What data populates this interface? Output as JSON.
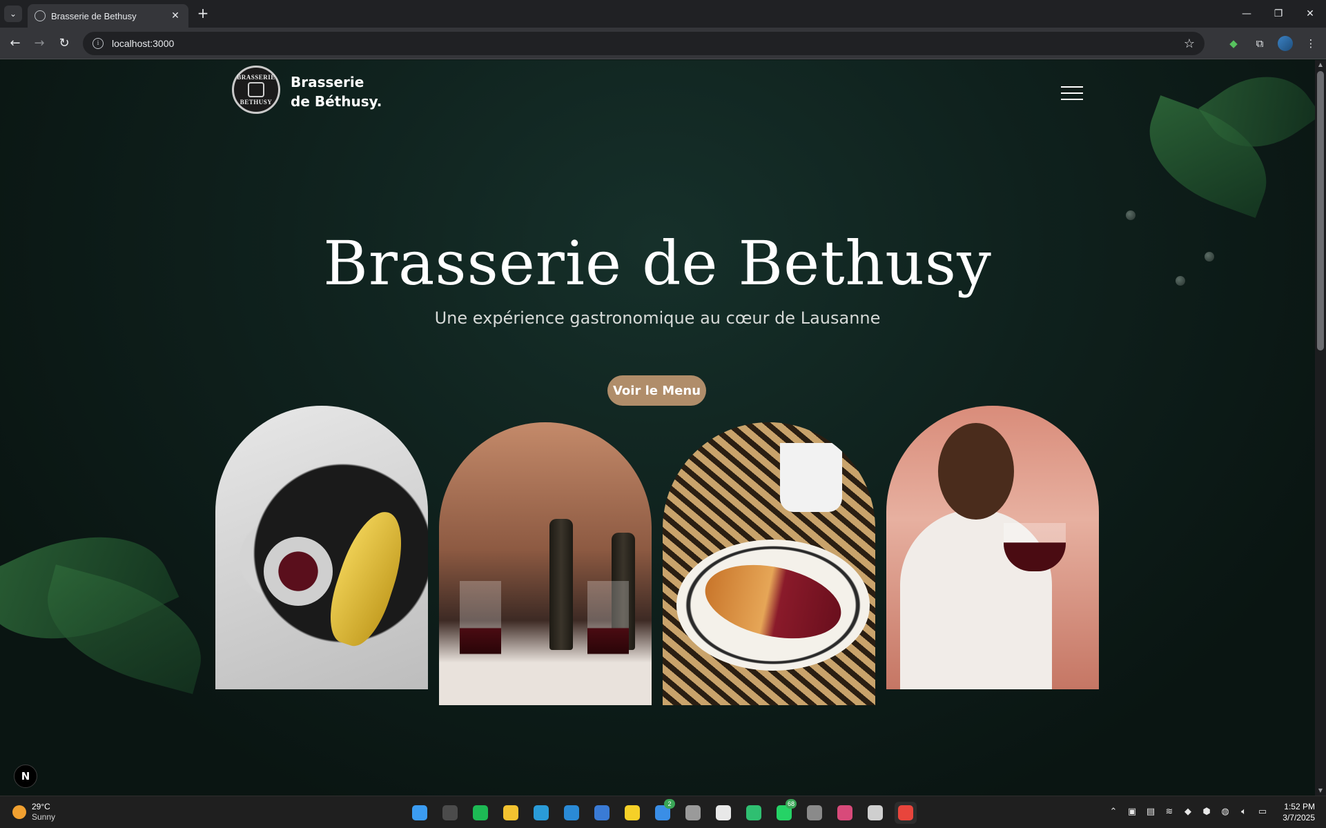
{
  "browser": {
    "tab_title": "Brasserie de Bethusy",
    "tab_close": "✕",
    "new_tab": "+",
    "url": "localhost:3000",
    "window_controls": {
      "minimize": "—",
      "restore": "❐",
      "close": "✕"
    }
  },
  "site": {
    "brand_line1": "Brasserie",
    "brand_line2": "de Béthusy.",
    "logo_text_top": "BRASSERIE",
    "logo_text_bottom": "BETHUSY",
    "hero_title": "Brasserie de Bethusy",
    "hero_subtitle": "Une expérience gastronomique au cœur de Lausanne",
    "cta_label": "Voir le Menu",
    "nextjs_badge": "N"
  },
  "taskbar": {
    "weather_temp": "29°C",
    "weather_condition": "Sunny",
    "apps": [
      {
        "name": "windows-start-icon",
        "color": "#3b9cf2",
        "badge": ""
      },
      {
        "name": "media-player-icon",
        "color": "#4b4b4b",
        "badge": ""
      },
      {
        "name": "spotify-icon",
        "color": "#1db954",
        "badge": ""
      },
      {
        "name": "file-explorer-icon",
        "color": "#f2c230",
        "badge": ""
      },
      {
        "name": "edge-icon",
        "color": "#2a9bd8",
        "badge": ""
      },
      {
        "name": "vscode-icon",
        "color": "#2a8ad6",
        "badge": ""
      },
      {
        "name": "app-store-icon",
        "color": "#3a7bd5",
        "badge": ""
      },
      {
        "name": "sticky-notes-icon",
        "color": "#f5d028",
        "badge": ""
      },
      {
        "name": "todo-icon",
        "color": "#3a8ee6",
        "badge": "2"
      },
      {
        "name": "microphone-app-icon",
        "color": "#9a9a9a",
        "badge": ""
      },
      {
        "name": "notion-icon",
        "color": "#e8e8e8",
        "badge": ""
      },
      {
        "name": "stacks-icon",
        "color": "#2fbf71",
        "badge": ""
      },
      {
        "name": "whatsapp-icon",
        "color": "#25d366",
        "badge": "68"
      },
      {
        "name": "circle-app-icon",
        "color": "#8a8a8a",
        "badge": ""
      },
      {
        "name": "color-app-icon",
        "color": "#d84a7a",
        "badge": ""
      },
      {
        "name": "clock-app-icon",
        "color": "#cfcfcf",
        "badge": ""
      },
      {
        "name": "chrome-icon",
        "color": "#e8453c",
        "badge": ""
      }
    ],
    "time": "1:52 PM",
    "date": "3/7/2025"
  },
  "colors": {
    "accent_button": "#b08d6a",
    "page_background": "#0f211d"
  }
}
